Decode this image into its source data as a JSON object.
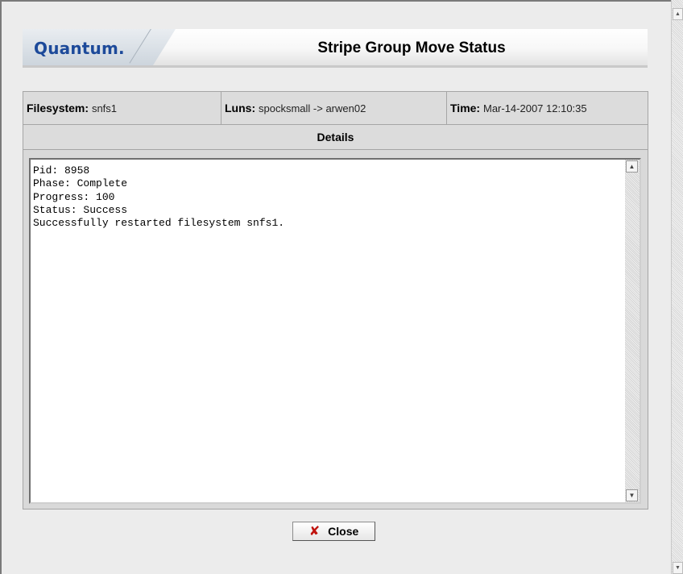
{
  "header": {
    "logo_text": "Quantum.",
    "title": "Stripe Group Move Status"
  },
  "info": {
    "filesystem_label": "Filesystem:",
    "filesystem_value": "snfs1",
    "luns_label": "Luns:",
    "luns_value": "spocksmall -> arwen02",
    "time_label": "Time:",
    "time_value": "Mar-14-2007 12:10:35"
  },
  "details": {
    "heading": "Details",
    "text": "Pid: 8958\nPhase: Complete\nProgress: 100\nStatus: Success\nSuccessfully restarted filesystem snfs1."
  },
  "close_button": {
    "label": "Close",
    "icon": "close-x-icon"
  },
  "colors": {
    "logo": "#1d4a9a",
    "close_icon": "#c0140f",
    "panel_background": "#d9d9d9"
  }
}
